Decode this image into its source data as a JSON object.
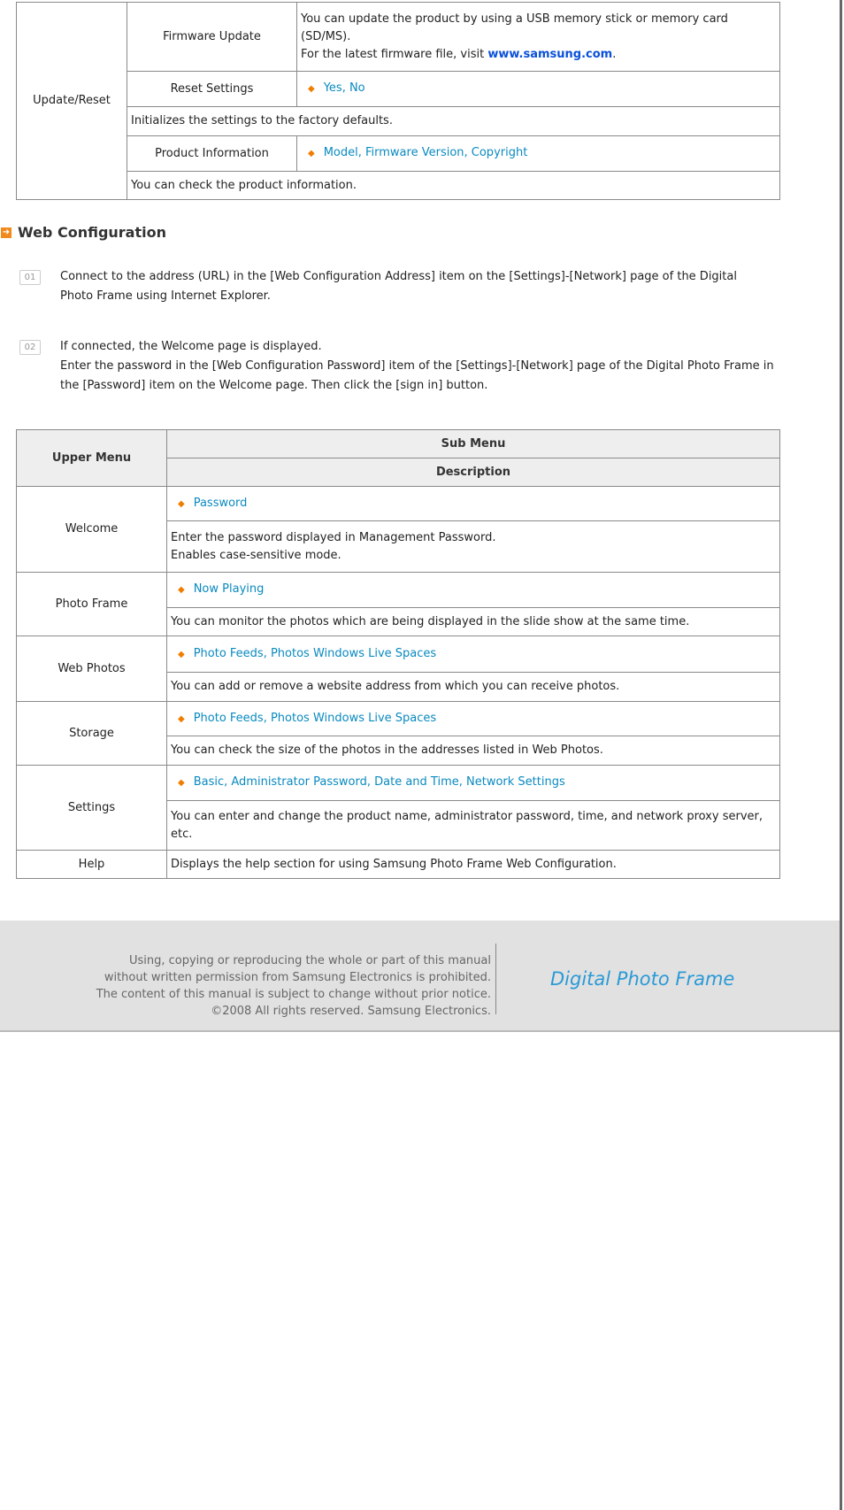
{
  "update_table": {
    "group": "Update/Reset",
    "firmware": {
      "label": "Firmware Update",
      "line1": "You can update the product by using a USB memory stick or memory card",
      "line2": "(SD/MS).",
      "line3_prefix": "For the latest firmware file, visit ",
      "link": "www.samsung.com",
      "line3_suffix": "."
    },
    "reset": {
      "label": "Reset Settings",
      "options": "Yes, No",
      "description": "Initializes the settings to the factory defaults."
    },
    "product_info": {
      "label": "Product Information",
      "options": "Model, Firmware Version, Copyright",
      "description": "You can check the product information."
    }
  },
  "section": {
    "title": "Web Configuration",
    "icon": "arrow-right-icon"
  },
  "steps": [
    {
      "num": "01",
      "lines": [
        "Connect to the address (URL) in the [Web Configuration Address] item on the [Settings]-[Network] page of the Digital",
        "Photo Frame using Internet Explorer."
      ]
    },
    {
      "num": "02",
      "lines": [
        "If connected, the Welcome page is displayed.",
        "Enter the password in the [Web Configuration Password] item of the [Settings]-[Network] page of the Digital Photo Frame in",
        "the [Password] item on the Welcome page. Then click the [sign in] button."
      ]
    }
  ],
  "menu_table": {
    "headers": {
      "upper": "Upper Menu",
      "sub": "Sub Menu",
      "description": "Description"
    },
    "rows": [
      {
        "menu": "Welcome",
        "sub": "Password",
        "desc1": "Enter the password displayed in Management Password.",
        "desc2": "Enables case-sensitive mode."
      },
      {
        "menu": "Photo Frame",
        "sub": "Now Playing",
        "desc1": "You can monitor the photos which are being displayed in the slide show at the same time."
      },
      {
        "menu": "Web Photos",
        "sub": "Photo Feeds, Photos Windows Live Spaces",
        "desc1": "You can add or remove a website address from which you can receive photos."
      },
      {
        "menu": "Storage",
        "sub": "Photo Feeds, Photos Windows Live Spaces",
        "desc1": "You can check the size of the photos in the addresses listed in Web Photos."
      },
      {
        "menu": "Settings",
        "sub": "Basic, Administrator Password, Date and Time, Network Settings",
        "desc1": "You can enter and change the product name, administrator password, time, and network proxy server,",
        "desc2": "etc."
      }
    ],
    "help": {
      "menu": "Help",
      "desc": "Displays the help section for using Samsung Photo Frame Web Configuration."
    }
  },
  "footer": {
    "lines": [
      "Using, copying or reproducing the whole or part of this manual",
      "without written permission from Samsung Electronics  is prohibited.",
      "The content of this manual is subject to change without prior notice.",
      "©2008 All rights reserved. Samsung Electronics."
    ],
    "logo": "Digital Photo Frame"
  },
  "colors": {
    "link": "#0a8ac0",
    "bullet": "#f07d00",
    "header_bg": "#eeeeee",
    "footer_bg": "#e1e1e1"
  }
}
